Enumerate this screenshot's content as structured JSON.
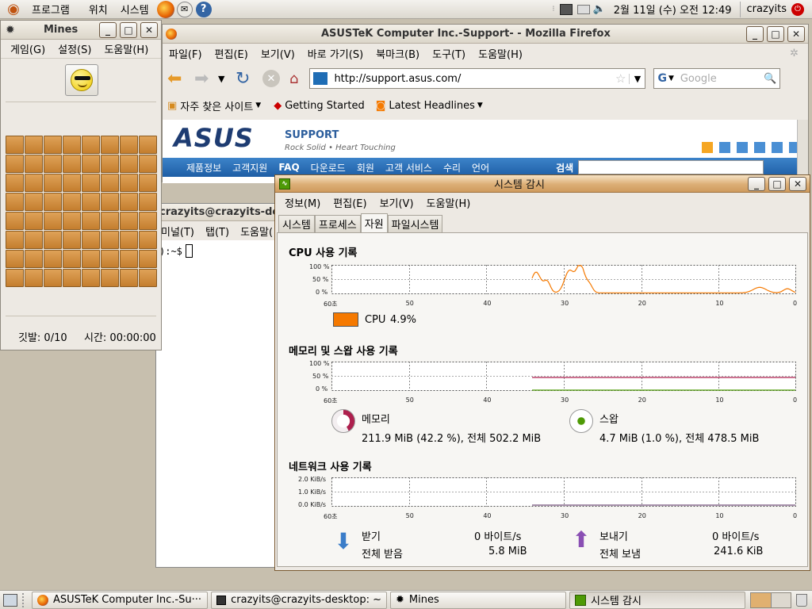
{
  "top_panel": {
    "menus": [
      "프로그램",
      "위치",
      "시스템"
    ],
    "clock": "2월 11일 (수) 오전 12:49",
    "user": "crazyits"
  },
  "mines": {
    "title": "Mines",
    "menu": [
      "게임(G)",
      "설정(S)",
      "도움말(H)"
    ],
    "flags": "깃발: 0/10",
    "time": "시간: 00:00:00",
    "rows": 8,
    "cols": 8
  },
  "firefox": {
    "title": "ASUSTeK Computer Inc.-Support- - Mozilla Firefox",
    "menu": [
      "파일(F)",
      "편집(E)",
      "보기(V)",
      "바로 가기(S)",
      "북마크(B)",
      "도구(T)",
      "도움말(H)"
    ],
    "url": "http://support.asus.com/",
    "search_placeholder": "Google",
    "bookmarks": [
      "자주 찾은 사이트",
      "Getting Started",
      "Latest Headlines"
    ],
    "asus": {
      "logo": "ASUS",
      "support": "SUPPORT",
      "tagline": "Rock Solid • Heart Touching",
      "nav": [
        "제품정보",
        "고객지원",
        "FAQ",
        "다운로드",
        "회원",
        "고객 서비스",
        "수리",
        "언어"
      ],
      "search_label": "검색"
    }
  },
  "terminal": {
    "title": "crazyits@crazyits-desktop: ~",
    "menu": [
      "미널(T)",
      "탭(T)",
      "도움말("
    ],
    "prompt": "):~$"
  },
  "sysmon": {
    "title": "시스템 감시",
    "menu": [
      "정보(M)",
      "편집(E)",
      "보기(V)",
      "도움말(H)"
    ],
    "tabs": [
      "시스템",
      "프로세스",
      "자원",
      "파일시스템"
    ],
    "active_tab": 2,
    "cpu": {
      "title": "CPU 사용 기록",
      "label": "CPU",
      "value": "4.9%",
      "color": "#f57900",
      "yticks": [
        "100 %",
        "50 %",
        "0 %"
      ]
    },
    "mem": {
      "title": "메모리 및 스왑 사용 기록",
      "yticks": [
        "100 %",
        "50 %",
        "0 %"
      ],
      "memory_label": "메모리",
      "memory_value": "211.9 MiB (42.2 %), 전체 502.2 MiB",
      "memory_color": "#ad1f4d",
      "swap_label": "스왑",
      "swap_value": "4.7 MiB (1.0 %), 전체 478.5 MiB",
      "swap_color": "#4e9a06"
    },
    "net": {
      "title": "네트워크 사용 기록",
      "yticks": [
        "2.0 KiB/s",
        "1.0 KiB/s",
        "0.0 KiB/s"
      ],
      "recv_label": "받기",
      "recv_rate": "0 바이트/s",
      "recv_total_label": "전체 받음",
      "recv_total": "5.8 MiB",
      "send_label": "보내기",
      "send_rate": "0 바이트/s",
      "send_total_label": "전체 보냄",
      "send_total": "241.6 KiB"
    },
    "xticks": [
      "60초",
      "50",
      "40",
      "30",
      "20",
      "10",
      "0"
    ]
  },
  "taskbar": [
    "ASUSTeK Computer Inc.-Su···",
    "crazyits@crazyits-desktop: ~",
    "Mines",
    "시스템 감시"
  ]
}
